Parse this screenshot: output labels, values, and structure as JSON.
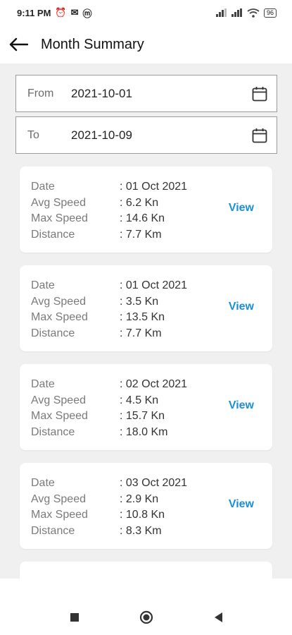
{
  "status_bar": {
    "time": "9:11 PM",
    "left_icons": [
      "alarm-icon",
      "mail-app-icon",
      "m-app-icon"
    ],
    "right_icons": [
      "signal-icon",
      "signal-icon",
      "wifi-icon",
      "battery-icon"
    ],
    "battery": "96"
  },
  "header": {
    "title": "Month Summary"
  },
  "filters": {
    "from_label": "From",
    "from_value": "2021-10-01",
    "to_label": "To",
    "to_value": "2021-10-09"
  },
  "labels": {
    "date": "Date",
    "avg_speed": "Avg Speed",
    "max_speed": "Max Speed",
    "distance": "Distance",
    "view": "View"
  },
  "cards": [
    {
      "date": ": 01 Oct 2021",
      "avg_speed": ": 6.2  Kn",
      "max_speed": ": 14.6  Kn",
      "distance": ": 7.7  Km"
    },
    {
      "date": ": 01 Oct 2021",
      "avg_speed": ": 3.5  Kn",
      "max_speed": ": 13.5  Kn",
      "distance": ": 7.7  Km"
    },
    {
      "date": ": 02 Oct 2021",
      "avg_speed": ": 4.5  Kn",
      "max_speed": ": 15.7  Kn",
      "distance": ": 18.0  Km"
    },
    {
      "date": ": 03 Oct 2021",
      "avg_speed": ": 2.9  Kn",
      "max_speed": ": 10.8  Kn",
      "distance": ": 8.3  Km"
    }
  ],
  "colors": {
    "accent": "#1a8fd8",
    "background": "#f0f0f0"
  }
}
